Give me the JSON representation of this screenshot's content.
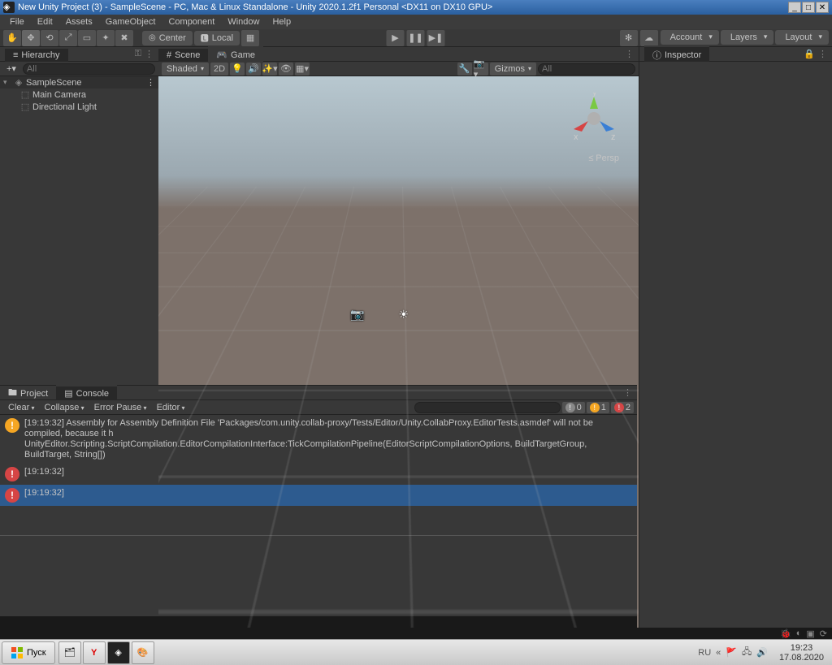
{
  "window": {
    "title": "New Unity Project (3) - SampleScene - PC, Mac & Linux Standalone - Unity 2020.1.2f1 Personal <DX11 on DX10 GPU>"
  },
  "menu": [
    "File",
    "Edit",
    "Assets",
    "GameObject",
    "Component",
    "Window",
    "Help"
  ],
  "toolbar": {
    "center_label": "Center",
    "local_label": "Local",
    "account": "Account",
    "layers": "Layers",
    "layout": "Layout"
  },
  "hierarchy": {
    "tab": "Hierarchy",
    "search_placeholder": "All",
    "scene": "SampleScene",
    "items": [
      "Main Camera",
      "Directional Light"
    ]
  },
  "scene": {
    "tab_scene": "Scene",
    "tab_game": "Game",
    "shading": "Shaded",
    "mode2d": "2D",
    "gizmos": "Gizmos",
    "search_placeholder": "All",
    "persp": "Persp",
    "axis_x": "x",
    "axis_y": "y",
    "axis_z": "z",
    "less": "≤"
  },
  "inspector": {
    "tab": "Inspector"
  },
  "bottom": {
    "tab_project": "Project",
    "tab_console": "Console",
    "clear": "Clear",
    "collapse": "Collapse",
    "error_pause": "Error Pause",
    "editor": "Editor",
    "badge_info": "0",
    "badge_warn": "1",
    "badge_err": "2",
    "logs": [
      {
        "type": "warn",
        "time": "[19:19:32]",
        "text": "Assembly for Assembly Definition File 'Packages/com.unity.collab-proxy/Tests/Editor/Unity.CollabProxy.EditorTests.asmdef' will not be compiled, because it h",
        "text2": "UnityEditor.Scripting.ScriptCompilation.EditorCompilationInterface:TickCompilationPipeline(EditorScriptCompilationOptions, BuildTargetGroup, BuildTarget, String[])"
      },
      {
        "type": "err",
        "time": "[19:19:32]",
        "text": ""
      },
      {
        "type": "err",
        "time": "[19:19:32]",
        "text": "",
        "selected": true
      }
    ]
  },
  "taskbar": {
    "start": "Пуск",
    "lang": "RU",
    "time": "19:23",
    "date": "17.08.2020"
  },
  "colors": {
    "warn": "#f5a623",
    "err": "#d64545",
    "info": "#888888",
    "selection": "#2d5b8f"
  }
}
